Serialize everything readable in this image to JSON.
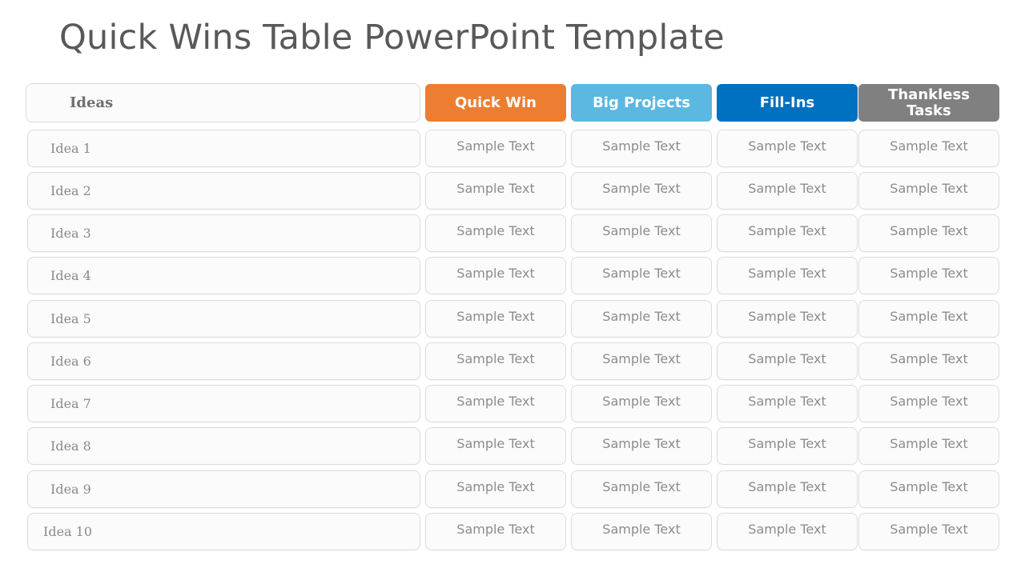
{
  "slide": {
    "title": "Quick Wins Table PowerPoint Template"
  },
  "table": {
    "headers": {
      "ideas": "Ideas",
      "quick_win": "Quick Win",
      "big_projects": "Big Projects",
      "fill_ins": "Fill-Ins",
      "thankless_tasks": "Thankless Tasks"
    },
    "colors": {
      "quick_win": "#ED7D31",
      "big_projects": "#5BB8E0",
      "fill_ins": "#0070C0",
      "thankless_tasks": "#808080"
    },
    "rows": [
      {
        "idea": "Idea 1",
        "quick_win": "Sample Text",
        "big_projects": "Sample Text",
        "fill_ins": "Sample Text",
        "thankless_tasks": "Sample Text"
      },
      {
        "idea": "Idea 2",
        "quick_win": "Sample Text",
        "big_projects": "Sample Text",
        "fill_ins": "Sample Text",
        "thankless_tasks": "Sample Text"
      },
      {
        "idea": "Idea 3",
        "quick_win": "Sample Text",
        "big_projects": "Sample Text",
        "fill_ins": "Sample Text",
        "thankless_tasks": "Sample Text"
      },
      {
        "idea": "Idea 4",
        "quick_win": "Sample Text",
        "big_projects": "Sample Text",
        "fill_ins": "Sample Text",
        "thankless_tasks": "Sample Text"
      },
      {
        "idea": "Idea 5",
        "quick_win": "Sample Text",
        "big_projects": "Sample Text",
        "fill_ins": "Sample Text",
        "thankless_tasks": "Sample Text"
      },
      {
        "idea": "Idea 6",
        "quick_win": "Sample Text",
        "big_projects": "Sample Text",
        "fill_ins": "Sample Text",
        "thankless_tasks": "Sample Text"
      },
      {
        "idea": "Idea 7",
        "quick_win": "Sample Text",
        "big_projects": "Sample Text",
        "fill_ins": "Sample Text",
        "thankless_tasks": "Sample Text"
      },
      {
        "idea": "Idea 8",
        "quick_win": "Sample Text",
        "big_projects": "Sample Text",
        "fill_ins": "Sample Text",
        "thankless_tasks": "Sample Text"
      },
      {
        "idea": "Idea 9",
        "quick_win": "Sample Text",
        "big_projects": "Sample Text",
        "fill_ins": "Sample Text",
        "thankless_tasks": "Sample Text"
      },
      {
        "idea": "Idea 10",
        "quick_win": "Sample Text",
        "big_projects": "Sample Text",
        "fill_ins": "Sample Text",
        "thankless_tasks": "Sample Text"
      }
    ]
  }
}
